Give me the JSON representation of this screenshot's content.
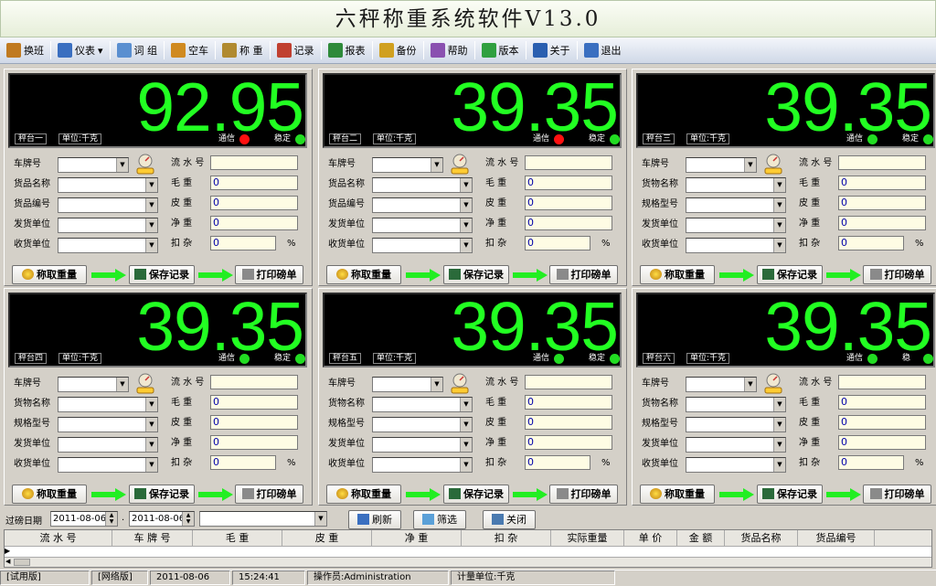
{
  "title": "六秤称重系统软件V13.0",
  "toolbar": [
    {
      "label": "换班",
      "icon": "handover-icon"
    },
    {
      "label": "仪表",
      "icon": "meter-icon",
      "dropdown": "▾"
    },
    {
      "label": "词 组",
      "icon": "phrase-icon"
    },
    {
      "label": "空车",
      "icon": "empty-truck-icon"
    },
    {
      "label": "称 重",
      "icon": "weigh-icon"
    },
    {
      "label": "记录",
      "icon": "records-icon"
    },
    {
      "label": "报表",
      "icon": "report-icon"
    },
    {
      "label": "备份",
      "icon": "backup-icon"
    },
    {
      "label": "帮助",
      "icon": "help-icon"
    },
    {
      "label": "版本",
      "icon": "version-icon"
    },
    {
      "label": "关于",
      "icon": "about-icon"
    },
    {
      "label": "退出",
      "icon": "exit-icon"
    }
  ],
  "panels": [
    {
      "weight": "92.95",
      "scale": "秤台一",
      "unit": "单位:千克",
      "comm_label": "通信",
      "comm_color": "#ff1010",
      "stable_label": "稳定",
      "stable_color": "#22dd22",
      "left_labels": [
        "车牌号",
        "货品名称",
        "货品编号",
        "发货单位",
        "收货单位"
      ],
      "right_labels": [
        "流 水 号",
        "毛   重",
        "皮   重",
        "净   重",
        "扣   杂"
      ],
      "values": [
        "",
        "0",
        "0",
        "0",
        "0"
      ],
      "percent": "%"
    },
    {
      "weight": "39.35",
      "scale": "秤台二",
      "unit": "单位:千克",
      "comm_label": "通信",
      "comm_color": "#ff1010",
      "stable_label": "稳定",
      "stable_color": "#22dd22",
      "left_labels": [
        "车牌号",
        "货品名称",
        "货品编号",
        "发货单位",
        "收货单位"
      ],
      "right_labels": [
        "流 水 号",
        "毛   重",
        "皮   重",
        "净   重",
        "扣   杂"
      ],
      "values": [
        "",
        "0",
        "0",
        "0",
        "0"
      ],
      "percent": "%"
    },
    {
      "weight": "39.35",
      "scale": "秤台三",
      "unit": "单位:千克",
      "comm_label": "通信",
      "comm_color": "#22dd22",
      "stable_label": "稳定",
      "stable_color": "#22dd22",
      "left_labels": [
        "车牌号",
        "货物名称",
        "规格型号",
        "发货单位",
        "收货单位"
      ],
      "right_labels": [
        "流 水 号",
        "毛   重",
        "皮   重",
        "净   重",
        "扣   杂"
      ],
      "values": [
        "",
        "0",
        "0",
        "0",
        "0"
      ],
      "percent": "%"
    },
    {
      "weight": "39.35",
      "scale": "秤台四",
      "unit": "单位:千克",
      "comm_label": "通信",
      "comm_color": "#22dd22",
      "stable_label": "稳定",
      "stable_color": "#22dd22",
      "left_labels": [
        "车牌号",
        "货物名称",
        "规格型号",
        "发货单位",
        "收货单位"
      ],
      "right_labels": [
        "流 水 号",
        "毛   重",
        "皮   重",
        "净   重",
        "扣   杂"
      ],
      "values": [
        "",
        "0",
        "0",
        "0",
        "0"
      ],
      "percent": "%"
    },
    {
      "weight": "39.35",
      "scale": "秤台五",
      "unit": "单位:千克",
      "comm_label": "通信",
      "comm_color": "#22dd22",
      "stable_label": "稳定",
      "stable_color": "#22dd22",
      "left_labels": [
        "车牌号",
        "货物名称",
        "规格型号",
        "发货单位",
        "收货单位"
      ],
      "right_labels": [
        "流 水 号",
        "毛   重",
        "皮   重",
        "净   重",
        "扣   杂"
      ],
      "values": [
        "",
        "0",
        "0",
        "0",
        "0"
      ],
      "percent": "%"
    },
    {
      "weight": "39.35",
      "scale": "秤台六",
      "unit": "单位:千克",
      "comm_label": "通信",
      "comm_color": "#22dd22",
      "stable_label": "稳",
      "stable_color": "#22dd22",
      "left_labels": [
        "车牌号",
        "货物名称",
        "规格型号",
        "发货单位",
        "收货单位"
      ],
      "right_labels": [
        "流 水 号",
        "毛   重",
        "皮   重",
        "净   重",
        "扣   杂"
      ],
      "values": [
        "",
        "0",
        "0",
        "0",
        "0"
      ],
      "percent": "%"
    }
  ],
  "buttons": {
    "weigh": "称取重量",
    "save": "保存记录",
    "print": "打印磅单"
  },
  "filter": {
    "label": "过磅日期",
    "date_from": "2011-08-06",
    "dot": ".",
    "date_to": "2011-08-06",
    "refresh": "刷新",
    "filter_btn": "筛选",
    "close": "关闭"
  },
  "grid_columns": [
    "流 水 号",
    "车 牌 号",
    "毛    重",
    "皮    重",
    "净    重",
    "扣    杂",
    "实际重量",
    "单  价",
    "金  额",
    "货品名称",
    "货品编号"
  ],
  "status": [
    "[试用版]",
    "[网络版]",
    "2011-08-06",
    "15:24:41",
    "操作员:Administration",
    "计量单位:千克"
  ],
  "colors": {
    "display_bg": "#000000",
    "digit": "#22ff22",
    "input_bg": "#fefce4",
    "arrow": "#22ee22"
  }
}
